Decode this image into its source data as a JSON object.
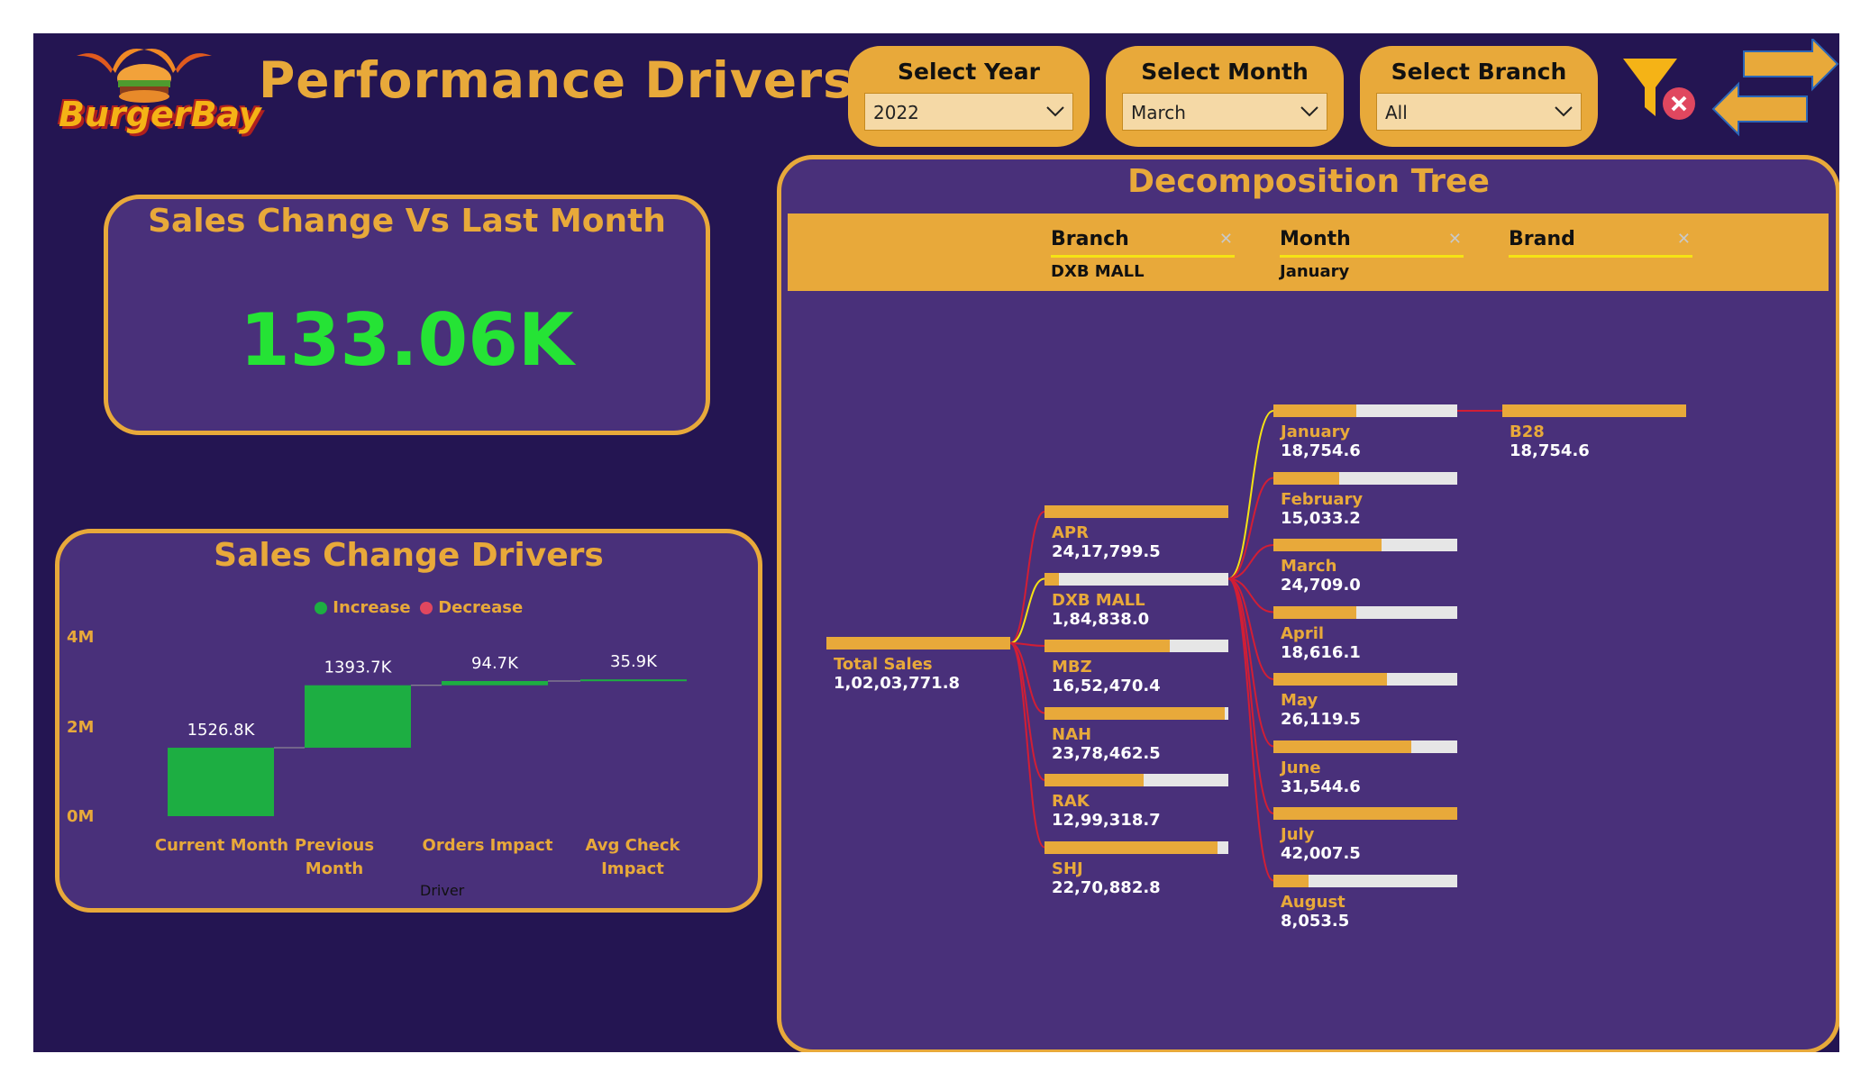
{
  "app": {
    "brand": "BurgerBay",
    "title": "Performance Drivers"
  },
  "slicers": [
    {
      "label": "Select Year",
      "value": "2022"
    },
    {
      "label": "Select Month",
      "value": "March"
    },
    {
      "label": "Select Branch",
      "value": "All"
    }
  ],
  "icons": {
    "clear_filter": "clear-filter-icon",
    "navigate": "navigation-arrows-icon",
    "dropdown": "chevron-down-icon"
  },
  "kpi": {
    "title": "Sales Change Vs Last Month",
    "value": "133.06K"
  },
  "colors": {
    "background": "#241552",
    "card": "#49307A",
    "accent": "#E8A93A",
    "increase": "#1DAE42",
    "decrease": "#E0475F",
    "kpi": "#25E335"
  },
  "chart_data": {
    "type": "bar",
    "subtype": "waterfall",
    "title": "Sales Change Drivers",
    "legend": [
      "Increase",
      "Decrease"
    ],
    "legend_position": "top-center",
    "categories": [
      "Current Month",
      "Previous Month",
      "Orders Impact",
      "Avg Check Impact"
    ],
    "values": [
      1526.8,
      1393.7,
      94.7,
      35.9
    ],
    "data_labels": [
      "1526.8K",
      "1393.7K",
      "94.7K",
      "35.9K"
    ],
    "xlabel": "Driver",
    "ylabel": "",
    "yticks": [
      "0M",
      "2M",
      "4M"
    ],
    "ylim": [
      0,
      4000
    ],
    "grid": false
  },
  "decomp": {
    "title": "Decomposition Tree",
    "levels": [
      {
        "label": "Branch",
        "selected": "DXB MALL"
      },
      {
        "label": "Month",
        "selected": "January"
      },
      {
        "label": "Brand",
        "selected": ""
      }
    ],
    "root": {
      "name": "Total Sales",
      "value": "1,02,03,771.8"
    },
    "branches": [
      {
        "name": "APR",
        "value": "24,17,799.5",
        "fill": 1.0
      },
      {
        "name": "DXB MALL",
        "value": "1,84,838.0",
        "fill": 0.08
      },
      {
        "name": "MBZ",
        "value": "16,52,470.4",
        "fill": 0.68
      },
      {
        "name": "NAH",
        "value": "23,78,462.5",
        "fill": 0.98
      },
      {
        "name": "RAK",
        "value": "12,99,318.7",
        "fill": 0.54
      },
      {
        "name": "SHJ",
        "value": "22,70,882.8",
        "fill": 0.94
      }
    ],
    "months": [
      {
        "name": "January",
        "value": "18,754.6",
        "fill": 0.45
      },
      {
        "name": "February",
        "value": "15,033.2",
        "fill": 0.36
      },
      {
        "name": "March",
        "value": "24,709.0",
        "fill": 0.59
      },
      {
        "name": "April",
        "value": "18,616.1",
        "fill": 0.45
      },
      {
        "name": "May",
        "value": "26,119.5",
        "fill": 0.62
      },
      {
        "name": "June",
        "value": "31,544.6",
        "fill": 0.75
      },
      {
        "name": "July",
        "value": "42,007.5",
        "fill": 1.0
      },
      {
        "name": "August",
        "value": "8,053.5",
        "fill": 0.19
      }
    ],
    "brands": [
      {
        "name": "B28",
        "value": "18,754.6",
        "fill": 1.0
      }
    ]
  }
}
